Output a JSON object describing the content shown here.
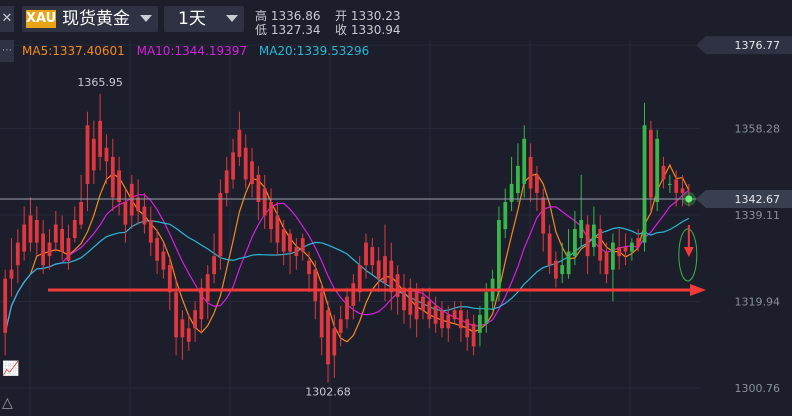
{
  "header": {
    "close_icon": "close-icon",
    "symbol_badge": "XAU",
    "symbol_name": "现货黄金",
    "period": "1天",
    "high_label": "高",
    "high_value": "1336.86",
    "low_label": "低",
    "low_value": "1327.34",
    "open_label": "开",
    "open_value": "1330.23",
    "close_label": "收",
    "close_value": "1330.94"
  },
  "indicators": {
    "ma5": {
      "label": "MA5:1337.40601",
      "color": "#f5891f"
    },
    "ma10": {
      "label": "MA10:1344.19397",
      "color": "#d81ee0"
    },
    "ma20": {
      "label": "MA20:1339.53296",
      "color": "#2ab8d6"
    }
  },
  "colors": {
    "background": "#1c1f2b",
    "up": "#39b54a",
    "down": "#e0383e",
    "annotation": "#f23a3a",
    "axis_text": "#8a8f9c"
  },
  "chart_data": {
    "type": "candlestick",
    "ylim": [
      1295,
      1385
    ],
    "price_ticks": [
      "1376.77",
      "1358.28",
      "1339.11",
      "1319.94",
      "1300.76"
    ],
    "last_price_tag": "1342.67",
    "last_price": 1342.67,
    "high_annotation": {
      "label": "1365.95",
      "value": 1365.95
    },
    "low_annotation": {
      "label": "1302.68",
      "value": 1302.68
    },
    "support_level": 1322.5,
    "candles": [
      [
        1325,
        1313,
        1327,
        1308
      ],
      [
        1327,
        1325,
        1334,
        1321
      ],
      [
        1333,
        1328,
        1336,
        1324
      ],
      [
        1337,
        1331,
        1341,
        1329
      ],
      [
        1339,
        1333,
        1343,
        1331
      ],
      [
        1338,
        1333,
        1341,
        1330
      ],
      [
        1335,
        1328,
        1338,
        1326
      ],
      [
        1333,
        1330,
        1336,
        1327
      ],
      [
        1337,
        1333,
        1340,
        1331
      ],
      [
        1336,
        1331,
        1339,
        1329
      ],
      [
        1334,
        1329,
        1337,
        1327
      ],
      [
        1338,
        1334,
        1341,
        1333
      ],
      [
        1342,
        1337,
        1348,
        1336
      ],
      [
        1359,
        1346,
        1362,
        1340
      ],
      [
        1356,
        1349,
        1360,
        1346
      ],
      [
        1360,
        1352,
        1366,
        1349
      ],
      [
        1354,
        1351,
        1357,
        1346
      ],
      [
        1352,
        1343,
        1356,
        1340
      ],
      [
        1349,
        1342,
        1352,
        1339
      ],
      [
        1342,
        1337,
        1345,
        1333
      ],
      [
        1346,
        1339,
        1348,
        1336
      ],
      [
        1343,
        1340,
        1347,
        1337
      ],
      [
        1341,
        1337,
        1344,
        1335
      ],
      [
        1338,
        1333,
        1341,
        1330
      ],
      [
        1334,
        1329,
        1336,
        1326
      ],
      [
        1331,
        1327,
        1333,
        1325
      ],
      [
        1328,
        1322,
        1330,
        1318
      ],
      [
        1322,
        1312,
        1325,
        1308
      ],
      [
        1316,
        1312,
        1318,
        1307
      ],
      [
        1314,
        1311,
        1317,
        1309
      ],
      [
        1318,
        1314,
        1320,
        1311
      ],
      [
        1323,
        1316,
        1325,
        1313
      ],
      [
        1326,
        1320,
        1328,
        1316
      ],
      [
        1330,
        1326,
        1335,
        1324
      ],
      [
        1344,
        1330,
        1347,
        1327
      ],
      [
        1349,
        1344,
        1352,
        1341
      ],
      [
        1353,
        1347,
        1356,
        1345
      ],
      [
        1358,
        1352,
        1362,
        1350
      ],
      [
        1354,
        1347,
        1357,
        1345
      ],
      [
        1351,
        1346,
        1354,
        1343
      ],
      [
        1348,
        1342,
        1350,
        1338
      ],
      [
        1345,
        1339,
        1348,
        1336
      ],
      [
        1342,
        1336,
        1345,
        1333
      ],
      [
        1339,
        1333,
        1342,
        1330
      ],
      [
        1336,
        1331,
        1338,
        1328
      ],
      [
        1335,
        1331,
        1336,
        1326
      ],
      [
        1332,
        1330,
        1334,
        1327
      ],
      [
        1334,
        1331,
        1335,
        1329
      ],
      [
        1329,
        1326,
        1331,
        1322
      ],
      [
        1327,
        1320,
        1329,
        1316
      ],
      [
        1322,
        1312,
        1324,
        1308
      ],
      [
        1318,
        1306,
        1320,
        1302
      ],
      [
        1314,
        1308,
        1317,
        1303
      ],
      [
        1316,
        1313,
        1319,
        1310
      ],
      [
        1321,
        1316,
        1323,
        1314
      ],
      [
        1324,
        1319,
        1326,
        1316
      ],
      [
        1328,
        1322,
        1330,
        1320
      ],
      [
        1333,
        1328,
        1335,
        1325
      ],
      [
        1332,
        1328,
        1334,
        1326
      ],
      [
        1329,
        1325,
        1332,
        1322
      ],
      [
        1330,
        1324,
        1337,
        1320
      ],
      [
        1329,
        1322,
        1333,
        1318
      ],
      [
        1326,
        1321,
        1328,
        1317
      ],
      [
        1323,
        1318,
        1326,
        1315
      ],
      [
        1323,
        1317,
        1325,
        1314
      ],
      [
        1322,
        1316,
        1324,
        1312
      ],
      [
        1321,
        1318,
        1323,
        1316
      ],
      [
        1320,
        1316,
        1323,
        1314
      ],
      [
        1319,
        1315,
        1321,
        1313
      ],
      [
        1318,
        1314,
        1320,
        1312
      ],
      [
        1317,
        1314,
        1319,
        1311
      ],
      [
        1318,
        1316,
        1320,
        1315
      ],
      [
        1318,
        1314,
        1320,
        1311
      ],
      [
        1316,
        1312,
        1318,
        1309
      ],
      [
        1315,
        1310,
        1317,
        1308
      ],
      [
        1313,
        1317,
        1319,
        1310
      ],
      [
        1315,
        1322,
        1324,
        1313
      ],
      [
        1320,
        1325,
        1327,
        1318
      ],
      [
        1322,
        1338,
        1341,
        1320
      ],
      [
        1336,
        1342,
        1345,
        1334
      ],
      [
        1342,
        1346,
        1352,
        1340
      ],
      [
        1344,
        1350,
        1355,
        1342
      ],
      [
        1346,
        1356,
        1359,
        1343
      ],
      [
        1352,
        1345,
        1355,
        1342
      ],
      [
        1348,
        1344,
        1350,
        1340
      ],
      [
        1343,
        1335,
        1345,
        1331
      ],
      [
        1335,
        1328,
        1337,
        1326
      ],
      [
        1329,
        1325,
        1331,
        1323
      ],
      [
        1326,
        1328,
        1333,
        1324
      ],
      [
        1326,
        1331,
        1336,
        1325
      ],
      [
        1330,
        1336,
        1340,
        1328
      ],
      [
        1334,
        1338,
        1348,
        1332
      ],
      [
        1337,
        1330,
        1339,
        1326
      ],
      [
        1332,
        1337,
        1341,
        1330
      ],
      [
        1336,
        1329,
        1339,
        1326
      ],
      [
        1331,
        1326,
        1333,
        1324
      ],
      [
        1327,
        1333,
        1335,
        1320
      ],
      [
        1332,
        1330,
        1336,
        1327
      ],
      [
        1332,
        1331,
        1335,
        1328
      ],
      [
        1331,
        1333,
        1334,
        1329
      ],
      [
        1334,
        1332,
        1336,
        1331
      ],
      [
        1333,
        1359,
        1364,
        1331
      ],
      [
        1358,
        1343,
        1360,
        1340
      ],
      [
        1342,
        1356,
        1358,
        1340
      ],
      [
        1350,
        1347,
        1352,
        1345
      ],
      [
        1346,
        1346,
        1348,
        1344
      ],
      [
        1347,
        1344,
        1349,
        1341
      ],
      [
        1345,
        1344,
        1348,
        1341
      ],
      [
        1343,
        1342,
        1346,
        1341
      ]
    ]
  }
}
